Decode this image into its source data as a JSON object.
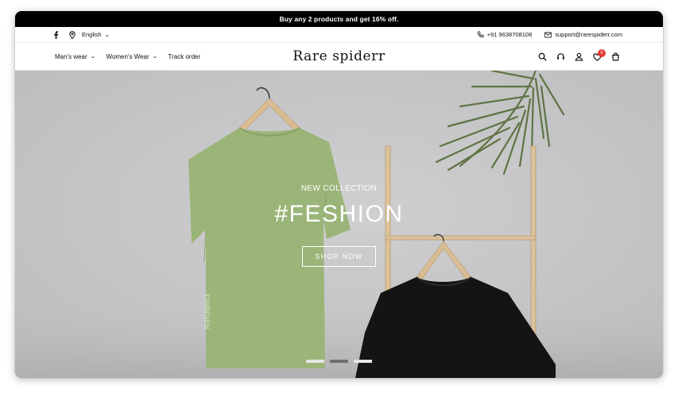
{
  "announcement": {
    "text": "Buy any 2 products and get 16% off."
  },
  "topbar": {
    "language": "English",
    "phone": "+91 9638708108",
    "email": "support@rarespiderr.com"
  },
  "nav": {
    "menu": [
      {
        "label": "Man's wear",
        "has_dropdown": true
      },
      {
        "label": "Women's Wear",
        "has_dropdown": true
      },
      {
        "label": "Track order",
        "has_dropdown": false
      }
    ],
    "logo_text": "Rare spiderr",
    "icons": [
      "search-icon",
      "headset-icon",
      "user-icon",
      "heart-icon",
      "bag-icon"
    ],
    "wishlist_count": "0"
  },
  "hero": {
    "eyebrow": "NEW COLLECTION",
    "headline": "#FESHION",
    "cta_label": "SHOP NOW",
    "tshirt_print": "PERFORMANCE",
    "slides_total": 3,
    "active_slide": 2
  },
  "colors": {
    "announcement_bg": "#000000",
    "badge": "#e53935",
    "hero_bg": "#c6c6c8",
    "green_tee": "#9bb579",
    "black_tee": "#141414"
  }
}
